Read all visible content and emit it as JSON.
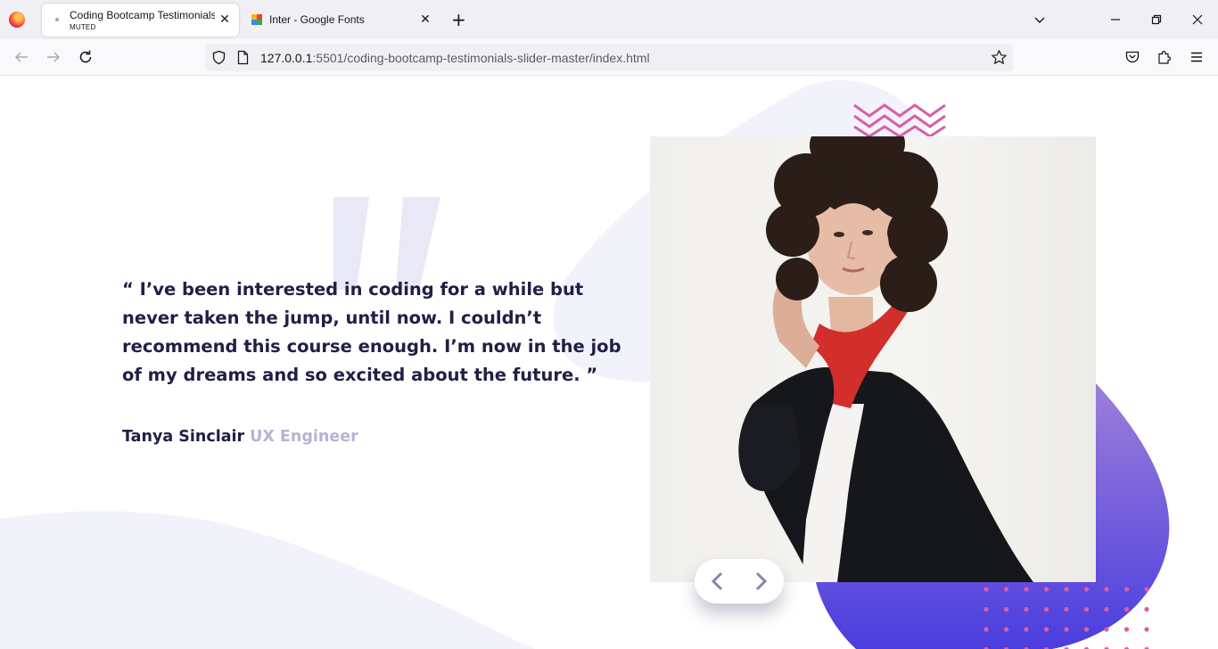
{
  "browser": {
    "tabs": [
      {
        "title": "Coding Bootcamp Testimonials",
        "subtitle": "MUTED",
        "active": true
      },
      {
        "title": "Inter - Google Fonts",
        "active": false
      }
    ],
    "url": {
      "host": "127.0.0.1",
      "rest": ":5501/coding-bootcamp-testimonials-slider-master/index.html"
    },
    "icons": {
      "back": "arrow-left-icon",
      "forward": "arrow-right-icon",
      "reload": "reload-icon",
      "shield": "shield-icon",
      "page": "page-icon",
      "bookmark": "star-icon",
      "pocket": "pocket-icon",
      "extensions": "puzzle-icon",
      "menu": "hamburger-icon"
    }
  },
  "testimonial": {
    "quote": "“ I’ve been interested in coding for a while but never taken the jump, until now. I couldn’t recommend this course enough. I’m now in the job of my dreams and so excited about the future. ”",
    "name": "Tanya Sinclair",
    "role": "UX Engineer"
  },
  "colors": {
    "dark_navy": "#202046",
    "grayish_blue": "#b5b4d3",
    "light_bg": "#f2f2fb",
    "purple": "#8e6ed8",
    "pink_accent": "#d95ea7"
  }
}
